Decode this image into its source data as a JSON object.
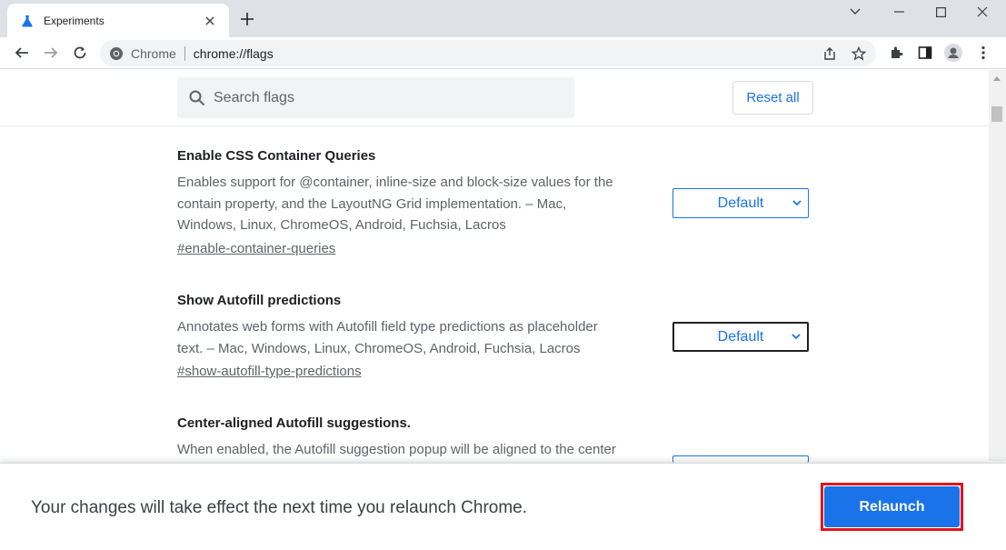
{
  "tab": {
    "title": "Experiments",
    "favicon": "flask-icon",
    "accent": "#1a73e8"
  },
  "toolbar": {
    "origin_label": "Chrome",
    "url": "chrome://flags"
  },
  "search": {
    "placeholder": "Search flags"
  },
  "reset_label": "Reset all",
  "flags": [
    {
      "title": "Enable CSS Container Queries",
      "desc_lines": [
        "Enables support for @container, inline-size and block-size values for the",
        "contain property, and the LayoutNG Grid implementation. – Mac,",
        "Windows, Linux, ChromeOS, Android, Fuchsia, Lacros"
      ],
      "link": "#enable-container-queries",
      "select_value": "Default"
    },
    {
      "title": "Show Autofill predictions",
      "desc_lines": [
        "Annotates web forms with Autofill field type predictions as placeholder",
        "text. – Mac, Windows, Linux, ChromeOS, Android, Fuchsia, Lacros"
      ],
      "link": "#show-autofill-type-predictions",
      "select_value": "Default"
    },
    {
      "title": "Center-aligned Autofill suggestions.",
      "desc_lines": [
        "When enabled, the Autofill suggestion popup will be aligned to the center"
      ]
    }
  ],
  "relaunch": {
    "message": "Your changes will take effect the next time you relaunch Chrome.",
    "button_label": "Relaunch",
    "highlight_color": "#e2141e"
  }
}
